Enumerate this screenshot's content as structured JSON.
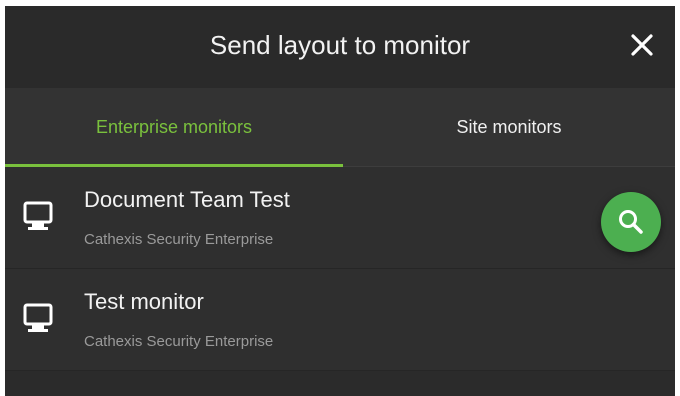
{
  "dialog": {
    "title": "Send layout to monitor",
    "close_icon": "close-icon"
  },
  "tabs": [
    {
      "label": "Enterprise monitors",
      "active": true
    },
    {
      "label": "Site monitors",
      "active": false
    }
  ],
  "monitors": [
    {
      "name": "Document Team Test",
      "subtitle": "Cathexis Security Enterprise",
      "icon": "monitor-icon"
    },
    {
      "name": "Test monitor",
      "subtitle": "Cathexis Security Enterprise",
      "icon": "monitor-icon"
    }
  ],
  "search_button": {
    "icon": "search-icon"
  },
  "colors": {
    "accent": "#7ac13d",
    "fab": "#4caf50",
    "background": "#2b2b2b"
  }
}
